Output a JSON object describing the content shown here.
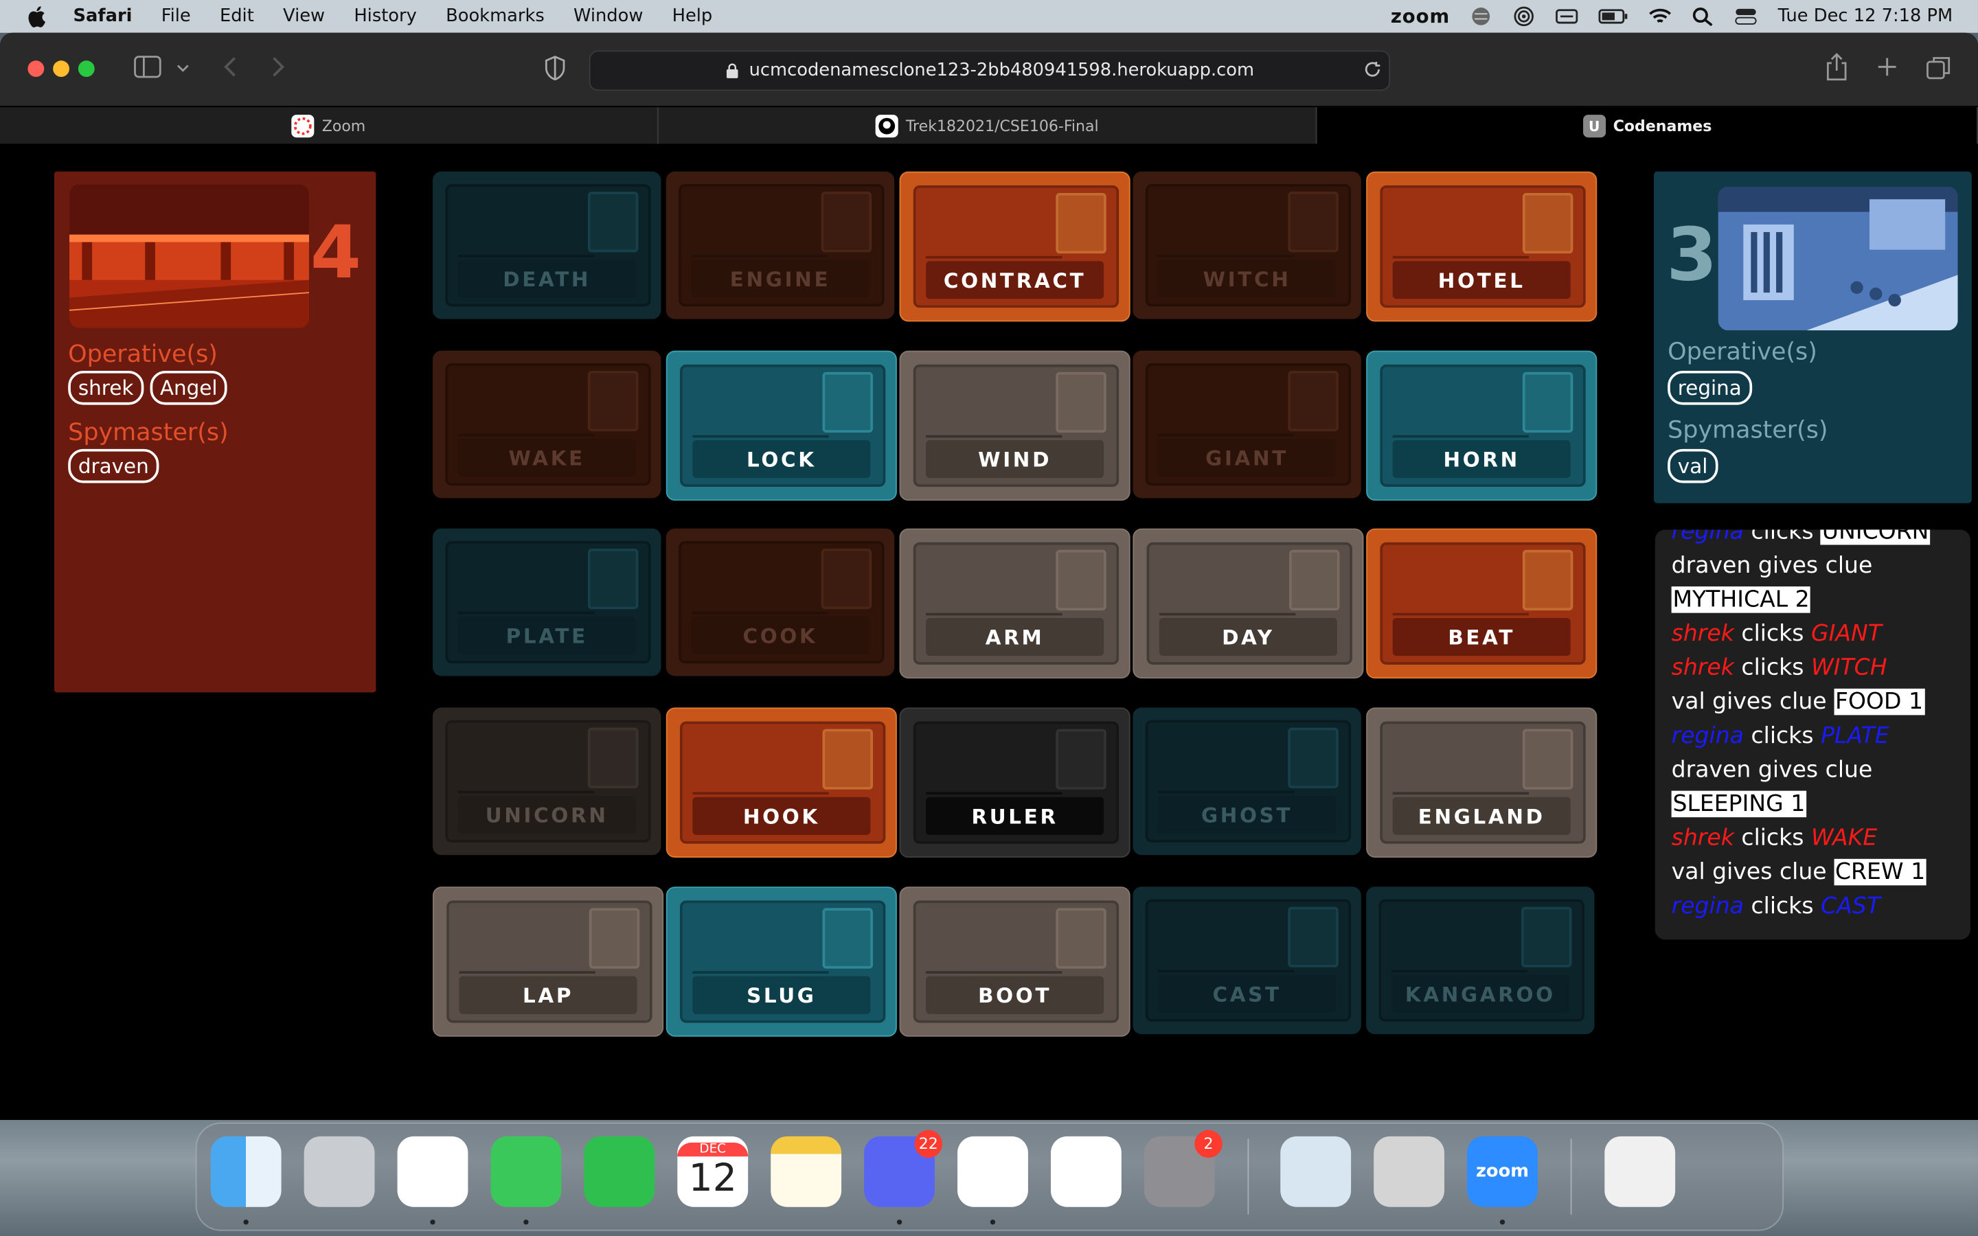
{
  "menubar": {
    "app": "Safari",
    "items": [
      "File",
      "Edit",
      "View",
      "History",
      "Bookmarks",
      "Window",
      "Help"
    ],
    "zoom_label": "zoom",
    "clock": "Tue Dec 12  7:18 PM"
  },
  "browser": {
    "url": "ucmcodenamesclone123-2bb480941598.herokuapp.com",
    "tabs": [
      {
        "label": "Zoom",
        "icon": "zoom-favicon"
      },
      {
        "label": "Trek182021/CSE106-Final",
        "icon": "github-favicon"
      },
      {
        "label": "Codenames",
        "icon": "u-favicon"
      }
    ]
  },
  "red_team": {
    "score": "4",
    "operatives_label": "Operative(s)",
    "operatives": [
      "shrek",
      "Angel"
    ],
    "spymasters_label": "Spymaster(s)",
    "spymasters": [
      "draven"
    ],
    "accent": "#e2502b"
  },
  "blue_team": {
    "score": "3",
    "operatives_label": "Operative(s)",
    "operatives": [
      "regina"
    ],
    "spymasters_label": "Spymaster(s)",
    "spymasters": [
      "val"
    ],
    "accent": "#7fa7b2"
  },
  "board": [
    [
      {
        "word": "DEATH",
        "color": "teal-dim"
      },
      {
        "word": "ENGINE",
        "color": "red-dim"
      },
      {
        "word": "CONTRACT",
        "color": "orange"
      },
      {
        "word": "WITCH",
        "color": "red-dim"
      },
      {
        "word": "HOTEL",
        "color": "orange"
      }
    ],
    [
      {
        "word": "WAKE",
        "color": "red-dim"
      },
      {
        "word": "LOCK",
        "color": "teal"
      },
      {
        "word": "WIND",
        "color": "tan"
      },
      {
        "word": "GIANT",
        "color": "red-dim"
      },
      {
        "word": "HORN",
        "color": "teal"
      }
    ],
    [
      {
        "word": "PLATE",
        "color": "teal-dim"
      },
      {
        "word": "COOK",
        "color": "red-dim"
      },
      {
        "word": "ARM",
        "color": "tan"
      },
      {
        "word": "DAY",
        "color": "tan"
      },
      {
        "word": "BEAT",
        "color": "orange"
      }
    ],
    [
      {
        "word": "UNICORN",
        "color": "tan-dim"
      },
      {
        "word": "HOOK",
        "color": "orange"
      },
      {
        "word": "RULER",
        "color": "black"
      },
      {
        "word": "GHOST",
        "color": "teal-dim"
      },
      {
        "word": "ENGLAND",
        "color": "tan"
      }
    ],
    [
      {
        "word": "LAP",
        "color": "tan"
      },
      {
        "word": "SLUG",
        "color": "teal"
      },
      {
        "word": "BOOT",
        "color": "tan"
      },
      {
        "word": "CAST",
        "color": "teal-dim"
      },
      {
        "word": "KANGAROO",
        "color": "teal-dim"
      }
    ]
  ],
  "log": {
    "lines": [
      {
        "parts": [
          {
            "t": "regina",
            "c": "blue-name"
          },
          {
            "t": " clicks "
          },
          {
            "t": "UNICORN",
            "c": "hl"
          }
        ]
      },
      {
        "parts": [
          {
            "t": "draven gives clue"
          }
        ]
      },
      {
        "parts": [
          {
            "t": "MYTHICAL 2",
            "c": "hl"
          }
        ]
      },
      {
        "parts": [
          {
            "t": "shrek",
            "c": "red-name"
          },
          {
            "t": " clicks "
          },
          {
            "t": "GIANT",
            "c": "red-name"
          }
        ]
      },
      {
        "parts": [
          {
            "t": "shrek",
            "c": "red-name"
          },
          {
            "t": " clicks "
          },
          {
            "t": "WITCH",
            "c": "red-name"
          }
        ]
      },
      {
        "parts": [
          {
            "t": "val gives clue "
          },
          {
            "t": "FOOD 1",
            "c": "hl"
          }
        ]
      },
      {
        "parts": [
          {
            "t": "regina",
            "c": "blue-name"
          },
          {
            "t": " clicks "
          },
          {
            "t": "PLATE",
            "c": "blue-name"
          }
        ]
      },
      {
        "parts": [
          {
            "t": "draven gives clue"
          }
        ]
      },
      {
        "parts": [
          {
            "t": "SLEEPING 1",
            "c": "hl"
          }
        ]
      },
      {
        "parts": [
          {
            "t": "shrek",
            "c": "red-name"
          },
          {
            "t": " clicks "
          },
          {
            "t": "WAKE",
            "c": "red-name"
          }
        ]
      },
      {
        "parts": [
          {
            "t": "val gives clue "
          },
          {
            "t": "CREW 1",
            "c": "hl"
          }
        ]
      },
      {
        "parts": [
          {
            "t": "regina",
            "c": "blue-name"
          },
          {
            "t": " clicks "
          },
          {
            "t": "CAST",
            "c": "blue-name"
          }
        ]
      }
    ]
  },
  "dock": {
    "apps": [
      {
        "name": "finder",
        "badge": ""
      },
      {
        "name": "launchpad",
        "badge": ""
      },
      {
        "name": "safari",
        "badge": ""
      },
      {
        "name": "messages",
        "badge": ""
      },
      {
        "name": "facetime",
        "badge": ""
      },
      {
        "name": "calendar",
        "badge": "",
        "month": "DEC",
        "day": "12"
      },
      {
        "name": "notes",
        "badge": ""
      },
      {
        "name": "discord",
        "badge": "22"
      },
      {
        "name": "vscode",
        "badge": ""
      },
      {
        "name": "word",
        "badge": ""
      },
      {
        "name": "system-preferences",
        "badge": "2"
      },
      {
        "name": "preview",
        "badge": ""
      },
      {
        "name": "calculator",
        "badge": ""
      },
      {
        "name": "zoom",
        "badge": "",
        "label": "zoom"
      },
      {
        "name": "documents",
        "badge": ""
      },
      {
        "name": "trash",
        "badge": ""
      }
    ]
  }
}
